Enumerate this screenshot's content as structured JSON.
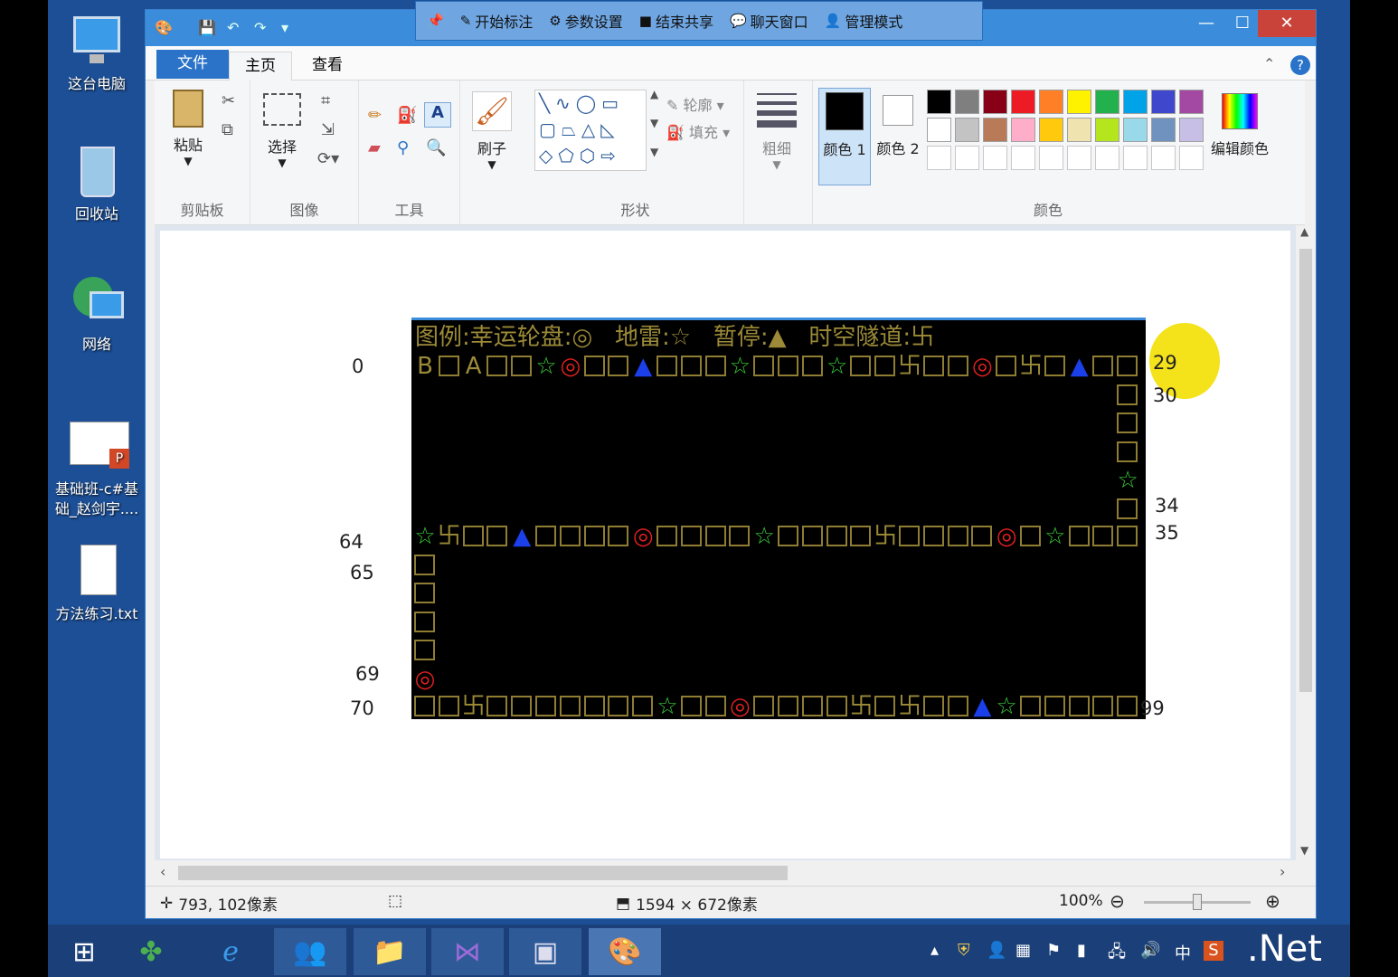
{
  "desktop": {
    "icons": [
      {
        "label": "这台电脑",
        "icon": "computer-icon"
      },
      {
        "label": "回收站",
        "icon": "recycle-bin-icon"
      },
      {
        "label": "网络",
        "icon": "network-icon"
      },
      {
        "label": "基础班-c#基础_赵剑宇....",
        "icon": "ppt-file-icon"
      },
      {
        "label": "方法练习.txt",
        "icon": "text-file-icon"
      }
    ]
  },
  "share_bar": {
    "items": [
      "开始标注",
      "参数设置",
      "结束共享",
      "聊天窗口",
      "管理模式"
    ]
  },
  "ribbon": {
    "tabs": {
      "file": "文件",
      "home": "主页",
      "view": "查看"
    },
    "clipboard": {
      "paste": "粘贴",
      "group": "剪贴板"
    },
    "image": {
      "select": "选择",
      "group": "图像"
    },
    "tools": {
      "group": "工具"
    },
    "brushes": {
      "label": "刷子"
    },
    "shapes": {
      "outline": "轮廓",
      "fill": "填充",
      "group": "形状"
    },
    "size": {
      "label": "粗细"
    },
    "colors": {
      "color1": "颜色 1",
      "color2": "颜色 2",
      "edit": "编辑颜色",
      "group": "颜色",
      "palette_row1": [
        "#000000",
        "#7f7f7f",
        "#880015",
        "#ed1c24",
        "#ff7f27",
        "#fff200",
        "#22b14c",
        "#00a2e8",
        "#3f48cc",
        "#a349a4"
      ],
      "palette_row2": [
        "#ffffff",
        "#c3c3c3",
        "#b97a57",
        "#ffaec9",
        "#ffc90e",
        "#efe4b0",
        "#b5e61d",
        "#99d9ea",
        "#7092be",
        "#c8bfe7"
      ]
    }
  },
  "game": {
    "legend": "图例:幸运轮盘:◎   地雷:☆   暂停:▲   时空隧道:卐",
    "row_top": "B□A□□☆◎□□▲□□□☆□□□☆□□卐□□◎□卐□▲□□",
    "row_mid": "☆卐□□▲□□□□◎□□□□☆□□□□卐□□□□◎□☆□□□",
    "row_bottom": "□□卐□□□□□□□☆□□◎□□□□卐□卐□□▲☆□□□□□",
    "col_right": [
      "□",
      "□",
      "□",
      "☆",
      "□"
    ],
    "col_left": [
      "□",
      "□",
      "□",
      "□",
      "◎"
    ]
  },
  "annotations": {
    "n0": "0",
    "n29": "29",
    "n30": "30",
    "n34": "34",
    "n35": "35",
    "n64": "64",
    "n65": "65",
    "n69": "69",
    "n70": "70",
    "n99": "99"
  },
  "statusbar": {
    "cursor_pos": "793, 102像素",
    "image_size": "1594 × 672像素",
    "zoom": "100%"
  },
  "taskbar": {
    "apps": [
      "start-icon",
      "lucky-clover-icon",
      "ie-icon",
      "users-icon",
      "folder-app-icon",
      "visual-studio-icon",
      "window-app-icon",
      "paint-icon"
    ],
    "tray_ime": "中",
    "brand": ".Net"
  }
}
